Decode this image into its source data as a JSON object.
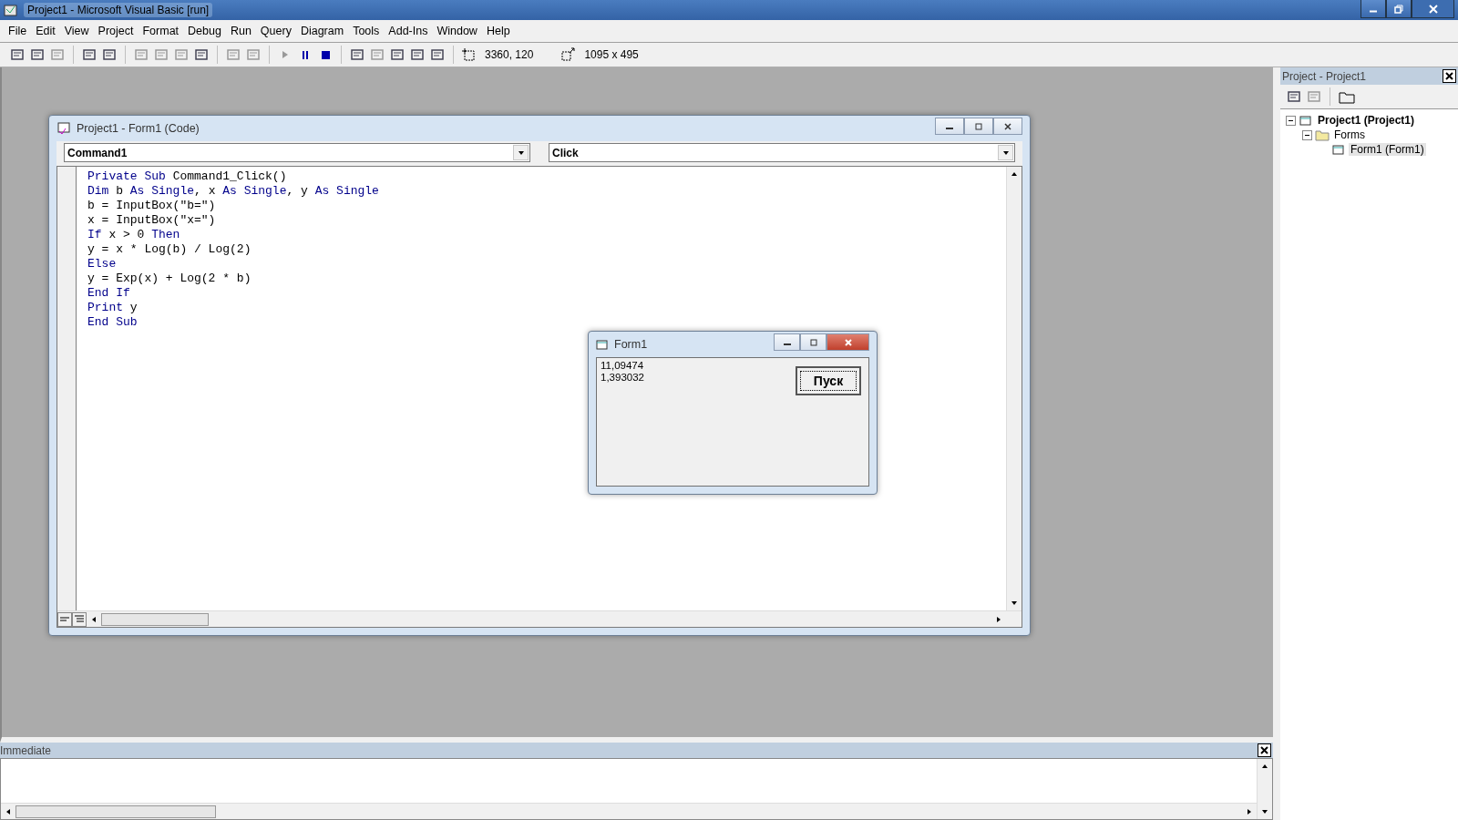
{
  "window": {
    "title": "Project1 - Microsoft Visual Basic [run]"
  },
  "menu": [
    "File",
    "Edit",
    "View",
    "Project",
    "Format",
    "Debug",
    "Run",
    "Query",
    "Diagram",
    "Tools",
    "Add-Ins",
    "Window",
    "Help"
  ],
  "toolbar": {
    "position": "3360, 120",
    "size": "1095 x 495"
  },
  "code_window": {
    "title": "Project1 - Form1 (Code)",
    "object": "Command1",
    "procedure": "Click",
    "lines": [
      [
        {
          "text": "Private Sub",
          "kind": "keyword"
        },
        {
          "text": " Command1_Click()",
          "kind": "plain"
        }
      ],
      [
        {
          "text": "Dim",
          "kind": "keyword"
        },
        {
          "text": " b ",
          "kind": "plain"
        },
        {
          "text": "As Single",
          "kind": "keyword"
        },
        {
          "text": ", x ",
          "kind": "plain"
        },
        {
          "text": "As Single",
          "kind": "keyword"
        },
        {
          "text": ", y ",
          "kind": "plain"
        },
        {
          "text": "As Single",
          "kind": "keyword"
        }
      ],
      [
        {
          "text": "b = InputBox(\"b=\")",
          "kind": "plain"
        }
      ],
      [
        {
          "text": "x = InputBox(\"x=\")",
          "kind": "plain"
        }
      ],
      [
        {
          "text": "If",
          "kind": "keyword"
        },
        {
          "text": " x > 0 ",
          "kind": "plain"
        },
        {
          "text": "Then",
          "kind": "keyword"
        }
      ],
      [
        {
          "text": "y = x * Log(b) / Log(2)",
          "kind": "plain"
        }
      ],
      [
        {
          "text": "Else",
          "kind": "keyword"
        }
      ],
      [
        {
          "text": "y = Exp(x) + Log(2 * b)",
          "kind": "plain"
        }
      ],
      [
        {
          "text": "End If",
          "kind": "keyword"
        }
      ],
      [
        {
          "text": "Print",
          "kind": "keyword"
        },
        {
          "text": " y",
          "kind": "plain"
        }
      ],
      [
        {
          "text": "End Sub",
          "kind": "keyword"
        }
      ]
    ]
  },
  "form_window": {
    "title": "Form1",
    "output": [
      "11,09474",
      "1,393032"
    ],
    "button": "Пуск"
  },
  "project_panel": {
    "title": "Project - Project1",
    "tree": [
      {
        "label": "Project1 (Project1)",
        "expanded": true,
        "selected": false,
        "children": [
          {
            "label": "Forms",
            "expanded": true,
            "selected": false,
            "children": [
              {
                "label": "Form1 (Form1)",
                "selected": true
              }
            ]
          }
        ]
      }
    ]
  },
  "immediate": {
    "title": "Immediate"
  }
}
